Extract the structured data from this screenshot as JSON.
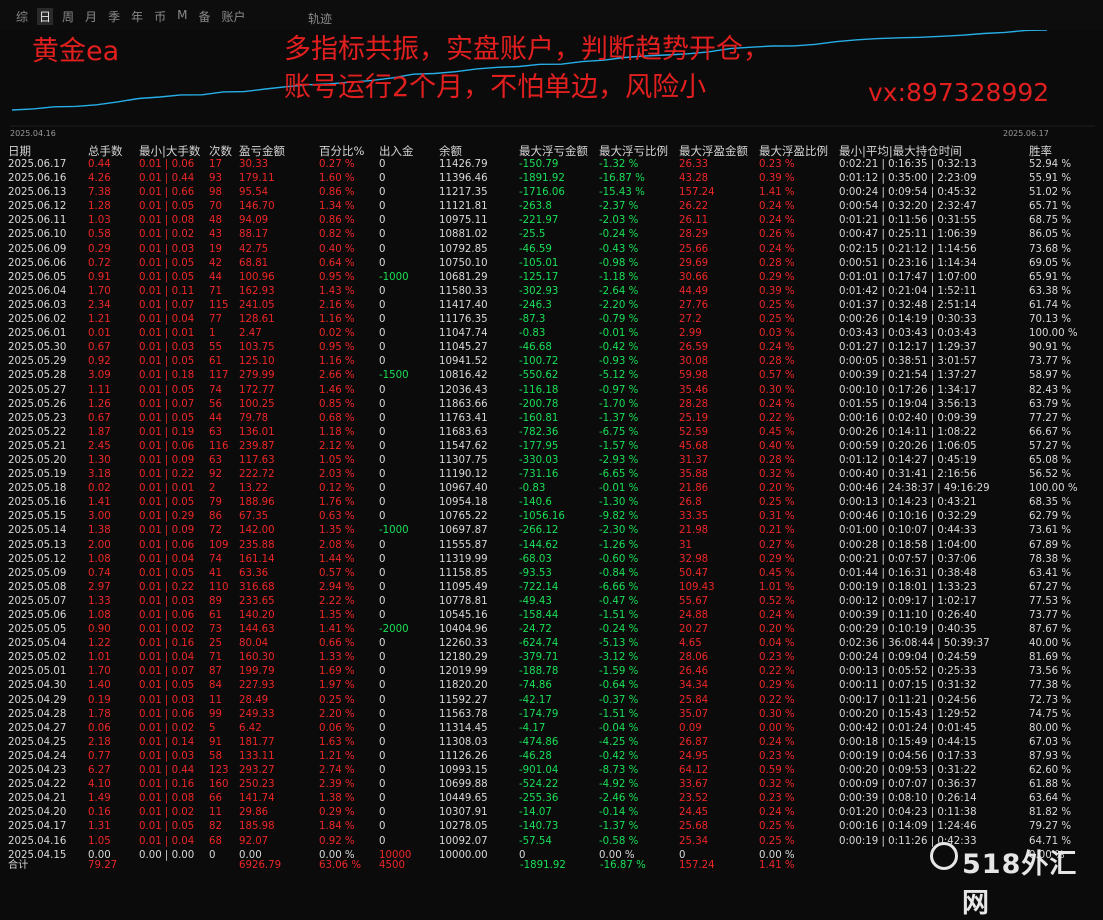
{
  "toolbar": {
    "tabs": [
      "综",
      "日",
      "周",
      "月",
      "季",
      "年",
      "币",
      "M",
      "备",
      "账户"
    ],
    "track": "轨迹"
  },
  "chart": {
    "start_date": "2025.04.16",
    "end_date": "2025.06.17",
    "annotations": {
      "title": "黄金ea",
      "line1": "多指标共振，实盘账户，判断趋势开仓，",
      "line2": "账号运行2个月，不怕单边，风险小",
      "contact": "vx:897328992"
    }
  },
  "table": {
    "headers": [
      "日期",
      "总手数",
      "最小|大手数",
      "次数",
      "盈亏金额",
      "百分比%",
      "出入金",
      "余额",
      "最大浮亏金额",
      "最大浮亏比例",
      "最大浮盈金额",
      "最大浮盈比例",
      "最小|平均|最大持仓时间",
      "胜率"
    ],
    "rows": [
      [
        "2025.06.17",
        "0.44",
        "0.01 | 0.06",
        "17",
        "30.33",
        "0.27 %",
        "0",
        "11426.79",
        "-150.79",
        "-1.32 %",
        "26.33",
        "0.23 %",
        "0:02:21 | 0:16:35 | 0:32:13",
        "52.94 %"
      ],
      [
        "2025.06.16",
        "4.26",
        "0.01 | 0.44",
        "93",
        "179.11",
        "1.60 %",
        "0",
        "11396.46",
        "-1891.92",
        "-16.87 %",
        "43.28",
        "0.39 %",
        "0:01:12 | 0:35:00 | 2:23:09",
        "55.91 %"
      ],
      [
        "2025.06.13",
        "7.38",
        "0.01 | 0.66",
        "98",
        "95.54",
        "0.86 %",
        "0",
        "11217.35",
        "-1716.06",
        "-15.43 %",
        "157.24",
        "1.41 %",
        "0:00:24 | 0:09:54 | 0:45:32",
        "51.02 %"
      ],
      [
        "2025.06.12",
        "1.28",
        "0.01 | 0.05",
        "70",
        "146.70",
        "1.34 %",
        "0",
        "11121.81",
        "-263.8",
        "-2.37 %",
        "26.22",
        "0.24 %",
        "0:00:54 | 0:32:20 | 2:32:47",
        "65.71 %"
      ],
      [
        "2025.06.11",
        "1.03",
        "0.01 | 0.08",
        "48",
        "94.09",
        "0.86 %",
        "0",
        "10975.11",
        "-221.97",
        "-2.03 %",
        "26.11",
        "0.24 %",
        "0:01:21 | 0:11:56 | 0:31:55",
        "68.75 %"
      ],
      [
        "2025.06.10",
        "0.58",
        "0.01 | 0.02",
        "43",
        "88.17",
        "0.82 %",
        "0",
        "10881.02",
        "-25.5",
        "-0.24 %",
        "28.29",
        "0.26 %",
        "0:00:47 | 0:25:11 | 1:06:39",
        "86.05 %"
      ],
      [
        "2025.06.09",
        "0.29",
        "0.01 | 0.03",
        "19",
        "42.75",
        "0.40 %",
        "0",
        "10792.85",
        "-46.59",
        "-0.43 %",
        "25.66",
        "0.24 %",
        "0:02:15 | 0:21:12 | 1:14:56",
        "73.68 %"
      ],
      [
        "2025.06.06",
        "0.72",
        "0.01 | 0.05",
        "42",
        "68.81",
        "0.64 %",
        "0",
        "10750.10",
        "-105.01",
        "-0.98 %",
        "29.69",
        "0.28 %",
        "0:00:51 | 0:23:16 | 1:14:34",
        "69.05 %"
      ],
      [
        "2025.06.05",
        "0.91",
        "0.01 | 0.05",
        "44",
        "100.96",
        "0.95 %",
        "-1000",
        "10681.29",
        "-125.17",
        "-1.18 %",
        "30.66",
        "0.29 %",
        "0:01:01 | 0:17:47 | 1:07:00",
        "65.91 %"
      ],
      [
        "2025.06.04",
        "1.70",
        "0.01 | 0.11",
        "71",
        "162.93",
        "1.43 %",
        "0",
        "11580.33",
        "-302.93",
        "-2.64 %",
        "44.49",
        "0.39 %",
        "0:01:42 | 0:21:04 | 1:52:11",
        "63.38 %"
      ],
      [
        "2025.06.03",
        "2.34",
        "0.01 | 0.07",
        "115",
        "241.05",
        "2.16 %",
        "0",
        "11417.40",
        "-246.3",
        "-2.20 %",
        "27.76",
        "0.25 %",
        "0:01:37 | 0:32:48 | 2:51:14",
        "61.74 %"
      ],
      [
        "2025.06.02",
        "1.21",
        "0.01 | 0.04",
        "77",
        "128.61",
        "1.16 %",
        "0",
        "11176.35",
        "-87.3",
        "-0.79 %",
        "27.2",
        "0.25 %",
        "0:00:26 | 0:14:19 | 0:30:33",
        "70.13 %"
      ],
      [
        "2025.06.01",
        "0.01",
        "0.01 | 0.01",
        "1",
        "2.47",
        "0.02 %",
        "0",
        "11047.74",
        "-0.83",
        "-0.01 %",
        "2.99",
        "0.03 %",
        "0:03:43 | 0:03:43 | 0:03:43",
        "100.00 %"
      ],
      [
        "2025.05.30",
        "0.67",
        "0.01 | 0.03",
        "55",
        "103.75",
        "0.95 %",
        "0",
        "11045.27",
        "-46.68",
        "-0.42 %",
        "26.59",
        "0.24 %",
        "0:01:27 | 0:12:17 | 1:29:37",
        "90.91 %"
      ],
      [
        "2025.05.29",
        "0.92",
        "0.01 | 0.05",
        "61",
        "125.10",
        "1.16 %",
        "0",
        "10941.52",
        "-100.72",
        "-0.93 %",
        "30.08",
        "0.28 %",
        "0:00:05 | 0:38:51 | 3:01:57",
        "73.77 %"
      ],
      [
        "2025.05.28",
        "3.09",
        "0.01 | 0.18",
        "117",
        "279.99",
        "2.66 %",
        "-1500",
        "10816.42",
        "-550.62",
        "-5.12 %",
        "59.98",
        "0.57 %",
        "0:00:39 | 0:21:54 | 1:37:27",
        "58.97 %"
      ],
      [
        "2025.05.27",
        "1.11",
        "0.01 | 0.05",
        "74",
        "172.77",
        "1.46 %",
        "0",
        "12036.43",
        "-116.18",
        "-0.97 %",
        "35.46",
        "0.30 %",
        "0:00:10 | 0:17:26 | 1:34:17",
        "82.43 %"
      ],
      [
        "2025.05.26",
        "1.26",
        "0.01 | 0.07",
        "56",
        "100.25",
        "0.85 %",
        "0",
        "11863.66",
        "-200.78",
        "-1.70 %",
        "28.28",
        "0.24 %",
        "0:01:55 | 0:19:04 | 3:56:13",
        "63.79 %"
      ],
      [
        "2025.05.23",
        "0.67",
        "0.01 | 0.05",
        "44",
        "79.78",
        "0.68 %",
        "0",
        "11763.41",
        "-160.81",
        "-1.37 %",
        "25.19",
        "0.22 %",
        "0:00:16 | 0:02:40 | 0:09:39",
        "77.27 %"
      ],
      [
        "2025.05.22",
        "1.87",
        "0.01 | 0.19",
        "63",
        "136.01",
        "1.18 %",
        "0",
        "11683.63",
        "-782.36",
        "-6.75 %",
        "52.59",
        "0.45 %",
        "0:00:26 | 0:14:11 | 1:08:22",
        "66.67 %"
      ],
      [
        "2025.05.21",
        "2.45",
        "0.01 | 0.06",
        "116",
        "239.87",
        "2.12 %",
        "0",
        "11547.62",
        "-177.95",
        "-1.57 %",
        "45.68",
        "0.40 %",
        "0:00:59 | 0:20:26 | 1:06:05",
        "57.27 %"
      ],
      [
        "2025.05.20",
        "1.30",
        "0.01 | 0.09",
        "63",
        "117.63",
        "1.05 %",
        "0",
        "11307.75",
        "-330.03",
        "-2.93 %",
        "31.37",
        "0.28 %",
        "0:01:12 | 0:14:27 | 0:45:19",
        "65.08 %"
      ],
      [
        "2025.05.19",
        "3.18",
        "0.01 | 0.22",
        "92",
        "222.72",
        "2.03 %",
        "0",
        "11190.12",
        "-731.16",
        "-6.65 %",
        "35.88",
        "0.32 %",
        "0:00:40 | 0:31:41 | 2:16:56",
        "56.52 %"
      ],
      [
        "2025.05.18",
        "0.02",
        "0.01 | 0.01",
        "2",
        "13.22",
        "0.12 %",
        "0",
        "10967.40",
        "-0.83",
        "-0.01 %",
        "21.86",
        "0.20 %",
        "0:00:46 | 24:38:37 | 49:16:29",
        "100.00 %"
      ],
      [
        "2025.05.16",
        "1.41",
        "0.01 | 0.05",
        "79",
        "188.96",
        "1.76 %",
        "0",
        "10954.18",
        "-140.6",
        "-1.30 %",
        "26.8",
        "0.25 %",
        "0:00:13 | 0:14:23 | 0:43:21",
        "68.35 %"
      ],
      [
        "2025.05.15",
        "3.00",
        "0.01 | 0.29",
        "86",
        "67.35",
        "0.63 %",
        "0",
        "10765.22",
        "-1056.16",
        "-9.82 %",
        "33.35",
        "0.31 %",
        "0:00:46 | 0:10:16 | 0:32:29",
        "62.79 %"
      ],
      [
        "2025.05.14",
        "1.38",
        "0.01 | 0.09",
        "72",
        "142.00",
        "1.35 %",
        "-1000",
        "10697.87",
        "-266.12",
        "-2.30 %",
        "21.98",
        "0.21 %",
        "0:01:00 | 0:10:07 | 0:44:33",
        "73.61 %"
      ],
      [
        "2025.05.13",
        "2.00",
        "0.01 | 0.06",
        "109",
        "235.88",
        "2.08 %",
        "0",
        "11555.87",
        "-144.62",
        "-1.26 %",
        "31",
        "0.27 %",
        "0:00:28 | 0:18:58 | 1:04:00",
        "67.89 %"
      ],
      [
        "2025.05.12",
        "1.08",
        "0.01 | 0.04",
        "74",
        "161.14",
        "1.44 %",
        "0",
        "11319.99",
        "-68.03",
        "-0.60 %",
        "32.98",
        "0.29 %",
        "0:00:21 | 0:07:57 | 0:37:06",
        "78.38 %"
      ],
      [
        "2025.05.09",
        "0.74",
        "0.01 | 0.05",
        "41",
        "63.36",
        "0.57 %",
        "0",
        "11158.85",
        "-93.53",
        "-0.84 %",
        "50.47",
        "0.45 %",
        "0:01:44 | 0:16:31 | 0:38:48",
        "63.41 %"
      ],
      [
        "2025.05.08",
        "2.97",
        "0.01 | 0.22",
        "110",
        "316.68",
        "2.94 %",
        "0",
        "11095.49",
        "-722.14",
        "-6.66 %",
        "109.43",
        "1.01 %",
        "0:00:19 | 0:18:01 | 1:33:23",
        "67.27 %"
      ],
      [
        "2025.05.07",
        "1.33",
        "0.01 | 0.03",
        "89",
        "233.65",
        "2.22 %",
        "0",
        "10778.81",
        "-49.43",
        "-0.47 %",
        "55.67",
        "0.52 %",
        "0:00:12 | 0:09:17 | 1:02:17",
        "77.53 %"
      ],
      [
        "2025.05.06",
        "1.08",
        "0.01 | 0.06",
        "61",
        "140.20",
        "1.35 %",
        "0",
        "10545.16",
        "-158.44",
        "-1.51 %",
        "24.88",
        "0.24 %",
        "0:00:39 | 0:11:10 | 0:26:40",
        "73.77 %"
      ],
      [
        "2025.05.05",
        "0.90",
        "0.01 | 0.02",
        "73",
        "144.63",
        "1.41 %",
        "-2000",
        "10404.96",
        "-24.72",
        "-0.24 %",
        "20.27",
        "0.20 %",
        "0:00:29 | 0:10:19 | 0:40:35",
        "87.67 %"
      ],
      [
        "2025.05.04",
        "1.22",
        "0.01 | 0.16",
        "25",
        "80.04",
        "0.66 %",
        "0",
        "12260.33",
        "-624.74",
        "-5.13 %",
        "4.65",
        "0.04 %",
        "0:02:36 | 36:08:44 | 50:39:37",
        "40.00 %"
      ],
      [
        "2025.05.02",
        "1.01",
        "0.01 | 0.04",
        "71",
        "160.30",
        "1.33 %",
        "0",
        "12180.29",
        "-379.71",
        "-3.12 %",
        "28.06",
        "0.23 %",
        "0:00:24 | 0:09:04 | 0:24:59",
        "81.69 %"
      ],
      [
        "2025.05.01",
        "1.70",
        "0.01 | 0.07",
        "87",
        "199.79",
        "1.69 %",
        "0",
        "12019.99",
        "-188.78",
        "-1.59 %",
        "26.46",
        "0.22 %",
        "0:00:13 | 0:05:52 | 0:25:33",
        "73.56 %"
      ],
      [
        "2025.04.30",
        "1.40",
        "0.01 | 0.05",
        "84",
        "227.93",
        "1.97 %",
        "0",
        "11820.20",
        "-74.86",
        "-0.64 %",
        "34.34",
        "0.29 %",
        "0:00:11 | 0:07:15 | 0:31:32",
        "77.38 %"
      ],
      [
        "2025.04.29",
        "0.19",
        "0.01 | 0.03",
        "11",
        "28.49",
        "0.25 %",
        "0",
        "11592.27",
        "-42.17",
        "-0.37 %",
        "25.84",
        "0.22 %",
        "0:00:17 | 0:11:21 | 0:24:56",
        "72.73 %"
      ],
      [
        "2025.04.28",
        "1.78",
        "0.01 | 0.06",
        "99",
        "249.33",
        "2.20 %",
        "0",
        "11563.78",
        "-174.79",
        "-1.51 %",
        "35.07",
        "0.30 %",
        "0:00:20 | 0:15:43 | 1:29:52",
        "74.75 %"
      ],
      [
        "2025.04.27",
        "0.06",
        "0.01 | 0.02",
        "5",
        "6.42",
        "0.06 %",
        "0",
        "11314.45",
        "-4.17",
        "-0.04 %",
        "0.09",
        "0.00 %",
        "0:00:42 | 0:01:24 | 0:01:45",
        "80.00 %"
      ],
      [
        "2025.04.25",
        "2.18",
        "0.01 | 0.14",
        "91",
        "181.77",
        "1.63 %",
        "0",
        "11308.03",
        "-474.86",
        "-4.25 %",
        "26.87",
        "0.24 %",
        "0:00:18 | 0:15:49 | 0:44:15",
        "67.03 %"
      ],
      [
        "2025.04.24",
        "0.77",
        "0.01 | 0.03",
        "58",
        "133.11",
        "1.21 %",
        "0",
        "11126.26",
        "-46.28",
        "-0.42 %",
        "24.95",
        "0.23 %",
        "0:00:19 | 0:04:56 | 0:17:33",
        "87.93 %"
      ],
      [
        "2025.04.23",
        "6.27",
        "0.01 | 0.44",
        "123",
        "293.27",
        "2.74 %",
        "0",
        "10993.15",
        "-901.04",
        "-8.73 %",
        "64.12",
        "0.59 %",
        "0:00:20 | 0:09:53 | 0:31:22",
        "62.60 %"
      ],
      [
        "2025.04.22",
        "4.10",
        "0.01 | 0.16",
        "160",
        "250.23",
        "2.39 %",
        "0",
        "10699.88",
        "-524.22",
        "-4.92 %",
        "33.67",
        "0.32 %",
        "0:00:09 | 0:07:07 | 0:36:37",
        "61.88 %"
      ],
      [
        "2025.04.21",
        "1.49",
        "0.01 | 0.08",
        "66",
        "141.74",
        "1.38 %",
        "0",
        "10449.65",
        "-255.36",
        "-2.46 %",
        "23.52",
        "0.23 %",
        "0:00:39 | 0:08:10 | 0:26:14",
        "63.64 %"
      ],
      [
        "2025.04.20",
        "0.16",
        "0.01 | 0.02",
        "11",
        "29.86",
        "0.29 %",
        "0",
        "10307.91",
        "-14.07",
        "-0.14 %",
        "24.45",
        "0.24 %",
        "0:01:20 | 0:04:23 | 0:11:38",
        "81.82 %"
      ],
      [
        "2025.04.17",
        "1.31",
        "0.01 | 0.05",
        "82",
        "185.98",
        "1.84 %",
        "0",
        "10278.05",
        "-140.73",
        "-1.37 %",
        "25.68",
        "0.25 %",
        "0:00:16 | 0:14:09 | 1:24:46",
        "79.27 %"
      ],
      [
        "2025.04.16",
        "1.05",
        "0.01 | 0.04",
        "68",
        "92.07",
        "0.92 %",
        "0",
        "10092.07",
        "-57.54",
        "-0.58 %",
        "25.34",
        "0.25 %",
        "0:00:19 | 0:11:26 | 0:42:33",
        "64.71 %"
      ],
      [
        "2025.04.15",
        "0.00",
        "0.00 | 0.00",
        "0",
        "0.00",
        "0.00 %",
        "10000",
        "10000.00",
        "0",
        "0.00 %",
        "0",
        "0.00 %",
        "",
        "0.00 %"
      ]
    ],
    "total": {
      "label": "合计",
      "lots": "79.27",
      "pnl": "6926.79",
      "pct": "63.06 %",
      "deposit": "4500",
      "max_float_loss": "-1891.92",
      "max_float_loss_pct": "-16.87 %",
      "max_float_profit": "157.24",
      "max_float_profit_pct": "1.41 %"
    }
  },
  "equity_curve": [
    10000,
    10092.07,
    10278.05,
    10307.91,
    10449.65,
    10699.88,
    10993.15,
    11126.26,
    11308.03,
    11314.45,
    11563.78,
    11592.27,
    11820.2,
    12019.99,
    12180.29,
    12260.33,
    12404.96,
    12545.16,
    12778.81,
    13095.49,
    13158.85,
    13319.99,
    13555.87,
    13697.87,
    13765.22,
    13954.18,
    13967.4,
    14190.12,
    14307.75,
    14547.62,
    14683.63,
    14763.41,
    14863.66,
    15036.43,
    15316.42,
    15441.52,
    15545.27,
    15547.74,
    15676.35,
    15917.4,
    16080.33,
    16181.29,
    16250.1,
    16292.85,
    16381.02,
    16475.11,
    16621.81,
    16717.35,
    16896.46,
    16926.79
  ],
  "colors": {
    "red": "#ee2626",
    "green": "#19e055",
    "curve": "#27aee6",
    "annotation": "#e21f1f"
  },
  "watermark": "518外汇网"
}
